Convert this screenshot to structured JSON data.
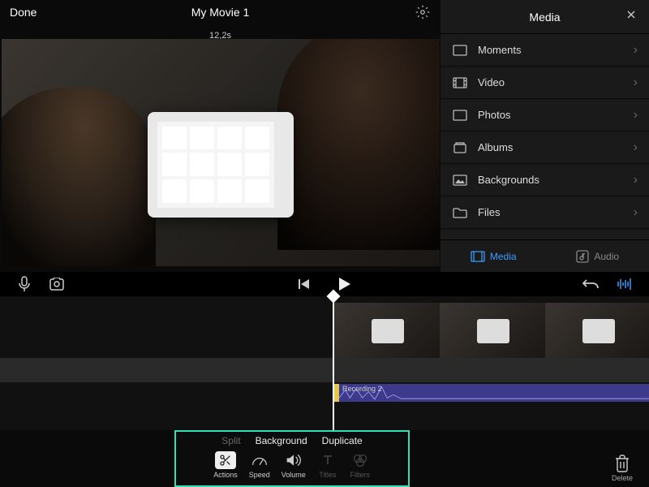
{
  "header": {
    "done": "Done",
    "title": "My Movie 1",
    "timecode": "12,2s"
  },
  "media": {
    "title": "Media",
    "items": [
      {
        "label": "Moments",
        "icon": "moments"
      },
      {
        "label": "Video",
        "icon": "video"
      },
      {
        "label": "Photos",
        "icon": "photos"
      },
      {
        "label": "Albums",
        "icon": "albums"
      },
      {
        "label": "Backgrounds",
        "icon": "backgrounds"
      },
      {
        "label": "Files",
        "icon": "files"
      }
    ],
    "tabs": {
      "media": "Media",
      "audio": "Audio"
    }
  },
  "timeline": {
    "audio_clip_label": "Recording 2"
  },
  "context_menu": {
    "split": "Split",
    "background": "Background",
    "duplicate": "Duplicate"
  },
  "tools": {
    "actions": "Actions",
    "speed": "Speed",
    "volume": "Volume",
    "titles": "Titles",
    "filters": "Filters"
  },
  "delete_label": "Delete"
}
